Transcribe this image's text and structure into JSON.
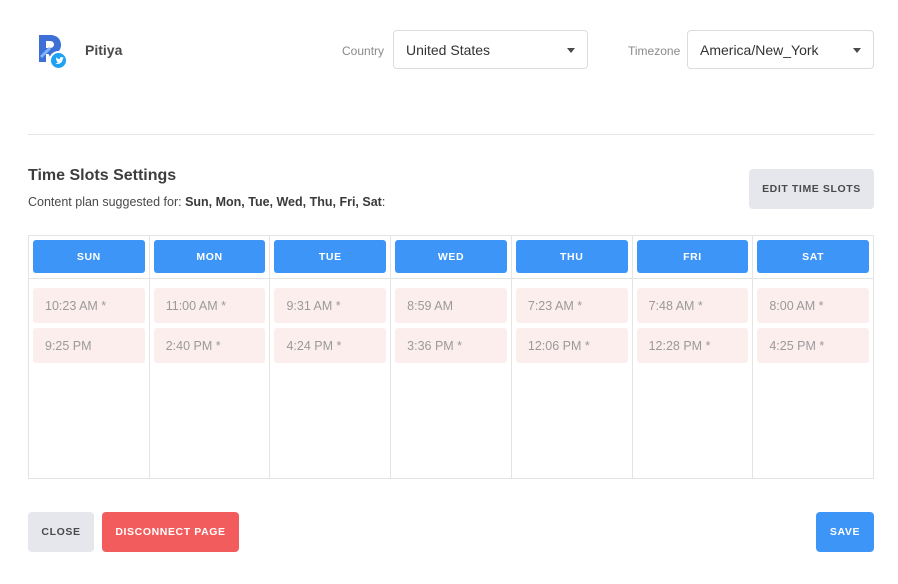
{
  "header": {
    "brand_name": "Pitiya",
    "country_label": "Country",
    "country_value": "United States",
    "timezone_label": "Timezone",
    "timezone_value": "America/New_York"
  },
  "time_slots": {
    "title": "Time Slots Settings",
    "subtitle_prefix": "Content plan suggested for:",
    "subtitle_days": "Sun, Mon, Tue, Wed, Thu, Fri, Sat",
    "subtitle_suffix": ":",
    "edit_label": "EDIT TIME SLOTS",
    "days": [
      {
        "label": "SUN",
        "slots": [
          "10:23 AM *",
          "9:25 PM"
        ]
      },
      {
        "label": "MON",
        "slots": [
          "11:00 AM *",
          "2:40 PM *"
        ]
      },
      {
        "label": "TUE",
        "slots": [
          "9:31 AM *",
          "4:24 PM *"
        ]
      },
      {
        "label": "WED",
        "slots": [
          "8:59 AM",
          "3:36 PM *"
        ]
      },
      {
        "label": "THU",
        "slots": [
          "7:23 AM *",
          "12:06 PM *"
        ]
      },
      {
        "label": "FRI",
        "slots": [
          "7:48 AM *",
          "12:28 PM *"
        ]
      },
      {
        "label": "SAT",
        "slots": [
          "8:00 AM *",
          "4:25 PM *"
        ]
      }
    ]
  },
  "footer": {
    "close_label": "CLOSE",
    "disconnect_label": "DISCONNECT PAGE",
    "save_label": "SAVE"
  },
  "colors": {
    "accent_blue": "#3d95f7",
    "danger_red": "#f25c5c",
    "slot_bg": "#fdeeee",
    "twitter_blue": "#1da1f2"
  },
  "icons": {
    "logo": "app-logo-icon",
    "badge": "twitter-icon",
    "dropdown": "caret-down-icon"
  }
}
